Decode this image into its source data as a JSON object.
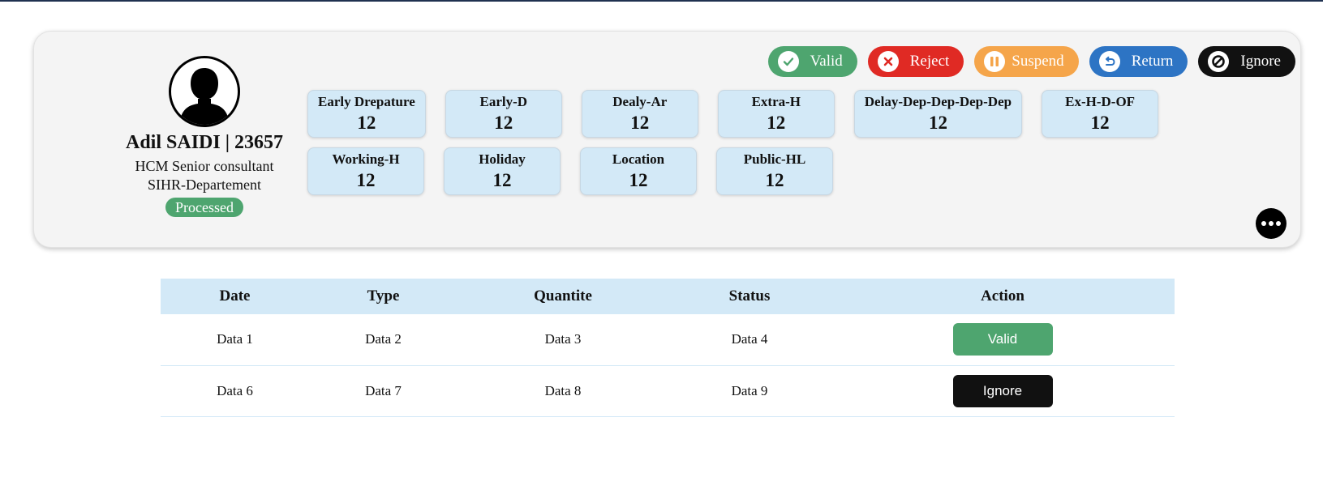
{
  "profile": {
    "name": "Adil SAIDI | 23657",
    "role": "HCM Senior consultant",
    "department": "SIHR-Departement",
    "status": "Processed"
  },
  "actions": [
    {
      "label": "Valid",
      "color": "#4ea56f",
      "icon": "check-icon"
    },
    {
      "label": "Reject",
      "color": "#e02a24",
      "icon": "x-icon"
    },
    {
      "label": "Suspend",
      "color": "#f5a54a",
      "icon": "pause-icon"
    },
    {
      "label": "Return",
      "color": "#2d74c4",
      "icon": "return-icon"
    },
    {
      "label": "Ignore",
      "color": "#111111",
      "icon": "ban-icon"
    }
  ],
  "counters_row1": [
    {
      "label": "Early Drepature",
      "value": "12"
    },
    {
      "label": "Early-D",
      "value": "12"
    },
    {
      "label": "Dealy-Ar",
      "value": "12"
    },
    {
      "label": "Extra-H",
      "value": "12"
    },
    {
      "label": "Delay-Dep-Dep-Dep-Dep",
      "value": "12"
    },
    {
      "label": "Ex-H-D-OF",
      "value": "12"
    }
  ],
  "counters_row2": [
    {
      "label": "Working-H",
      "value": "12"
    },
    {
      "label": "Holiday",
      "value": "12"
    },
    {
      "label": "Location",
      "value": "12"
    },
    {
      "label": "Public-HL",
      "value": "12"
    }
  ],
  "table": {
    "headers": [
      "Date",
      "Type",
      "Quantite",
      "Status",
      "Action"
    ],
    "rows": [
      {
        "cells": [
          "Data 1",
          "Data 2",
          "Data 3",
          "Data 4"
        ],
        "action": "Valid",
        "action_color": "#4ea56f"
      },
      {
        "cells": [
          "Data 6",
          "Data 7",
          "Data 8",
          "Data 9"
        ],
        "action": "Ignore",
        "action_color": "#111111"
      }
    ]
  }
}
